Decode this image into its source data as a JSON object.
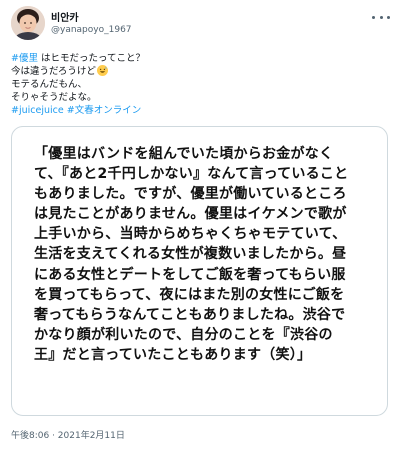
{
  "author": {
    "display_name": "비안카",
    "handle": "@yanapoyo_1967"
  },
  "tweet": {
    "lines": [
      {
        "hashtag": "#優里",
        "text": " はヒモだったってこと？"
      },
      {
        "text": "今は違うだろうけど"
      },
      {
        "text": "モテるんだもん、"
      },
      {
        "text": "そりゃそうだよな。"
      },
      {
        "hashtags": [
          "#juicejuice",
          "#文春オンライン"
        ]
      }
    ],
    "emoji": "grinning-sweat-emoji"
  },
  "quote": {
    "lines": [
      "「優里はバンドを組んでいた頃からお金がなく",
      "て、『あと2千円しかない』なんて言っていること",
      "もありました。ですが、優里が働いているところ",
      "は見たことがありません。優里はイケメンで歌が",
      "上手いから、当時からめちゃくちゃモテていて、",
      "生活を支えてくれる女性が複数いましたから。昼",
      "にある女性とデートをしてご飯を奢ってもらい服",
      "を買ってもらって、夜にはまた別の女性にご飯を",
      "奢ってもらうなんてこともありましたね。渋谷で",
      "かなり顔が利いたので、自分のことを『渋谷の",
      "王』だと言っていたこともあります（笑）」"
    ]
  },
  "timestamp": "午後8:06 · 2021年2月11日",
  "colors": {
    "link": "#1d9bf0",
    "secondary_text": "#536471",
    "border": "#cfd9de"
  },
  "icons": {
    "more": "more-horizontal-icon"
  }
}
